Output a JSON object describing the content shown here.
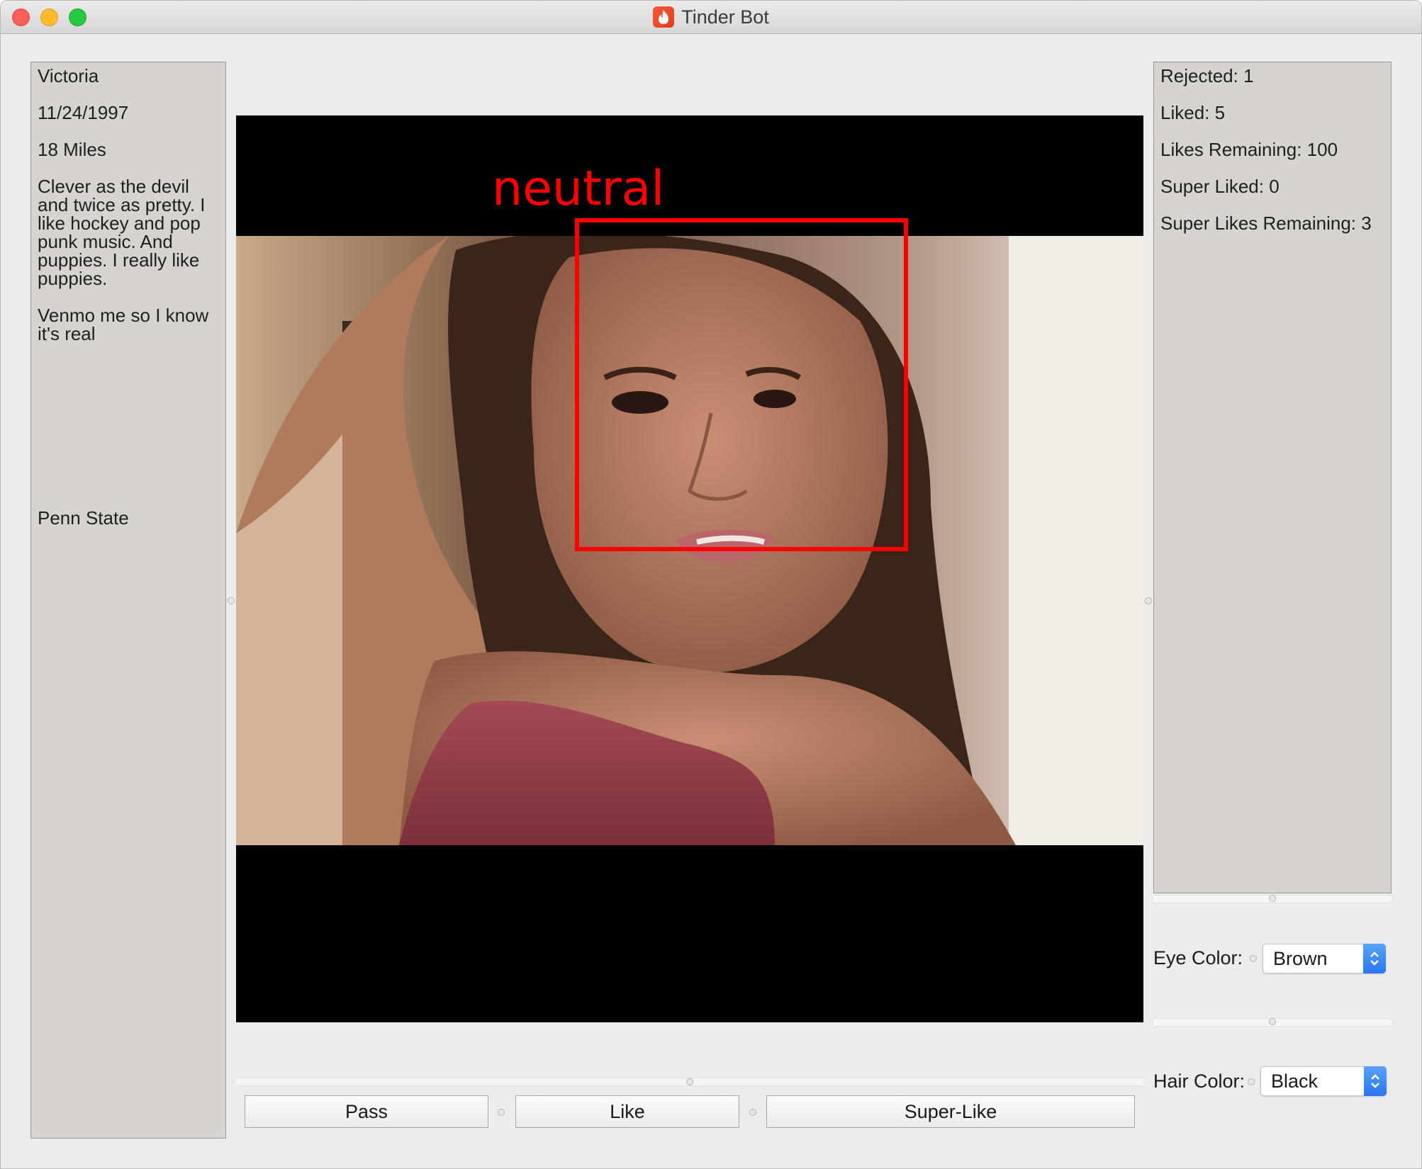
{
  "window": {
    "title": "Tinder Bot"
  },
  "profile": {
    "name": "Victoria",
    "birthdate": "11/24/1997",
    "distance": "18 Miles",
    "bio_paragraph_1": "Clever as the devil and twice as pretty. I like hockey and pop punk music. And puppies. I really like puppies.",
    "bio_paragraph_2": "Venmo me so I know it's real",
    "school": "Penn State"
  },
  "stats": {
    "rejected": "Rejected: 1",
    "liked": "Liked: 5",
    "likes_remaining": "Likes Remaining: 100",
    "super_liked": "Super Liked: 0",
    "super_likes_remaining": "Super Likes Remaining: 3"
  },
  "photo": {
    "emotion_label": "neutral"
  },
  "actions": {
    "pass_label": "Pass",
    "like_label": "Like",
    "super_like_label": "Super-Like"
  },
  "attributes": {
    "eye_color_label": "Eye Color:",
    "eye_color_value": "Brown",
    "hair_color_label": "Hair Color:",
    "hair_color_value": "Black"
  },
  "colors": {
    "face_box": "#ff0000",
    "panel_bg": "#d7d4cf",
    "select_accent": "#2a74f1"
  },
  "icons": {
    "app": "flame-icon",
    "select_arrows": "chevron-up-down-icon"
  }
}
